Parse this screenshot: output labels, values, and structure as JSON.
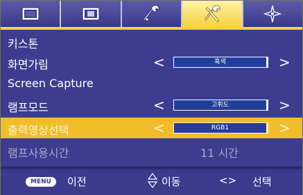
{
  "tabs": [
    {
      "icon": "picture-icon",
      "active": false
    },
    {
      "icon": "screen-icon",
      "active": false
    },
    {
      "icon": "wrench-icon",
      "active": false
    },
    {
      "icon": "tools-icon",
      "active": true
    },
    {
      "icon": "compass-icon",
      "active": false
    }
  ],
  "menu": {
    "keystone_label": "키스톤",
    "blank_label": "화면가림",
    "blank_value": "흑색",
    "capture_label": "Screen Capture",
    "lamp_mode_label": "램프모드",
    "lamp_mode_value": "고휘도",
    "output_label": "출력영상선택",
    "output_value": "RGB1",
    "lamp_hours_label": "램프사용시간",
    "lamp_hours_value": "11  시간",
    "arrow_left": "<",
    "arrow_right": ">"
  },
  "footer": {
    "menu_key": "MENU",
    "prev_label": "이전",
    "move_label": "이동",
    "lr_symbol": "<>",
    "select_label": "선택"
  },
  "colors": {
    "menu_bg": "#3c3d8f",
    "highlight": "#f1bd2a",
    "value_box": "#1f3f9b"
  }
}
